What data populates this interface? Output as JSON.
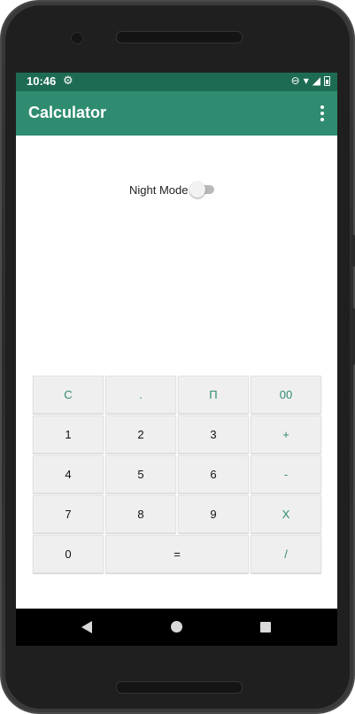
{
  "status_bar": {
    "time": "10:46",
    "icons": [
      "gear-icon",
      "do-not-disturb-icon",
      "wifi-icon",
      "signal-icon",
      "battery-icon"
    ]
  },
  "app_bar": {
    "title": "Calculator",
    "menu_icon": "more-vert-icon",
    "colors": {
      "app_bar": "#2f8c71",
      "status_bar": "#1e6b53"
    }
  },
  "night_mode": {
    "label": "Night Mode",
    "enabled": false
  },
  "keypad": {
    "accent_color": "#2f8c71",
    "rows": [
      [
        {
          "label": "C",
          "accent": true
        },
        {
          "label": ".",
          "accent": true
        },
        {
          "label": "Π",
          "accent": true
        },
        {
          "label": "00",
          "accent": true
        }
      ],
      [
        {
          "label": "1"
        },
        {
          "label": "2"
        },
        {
          "label": "3"
        },
        {
          "label": "+",
          "accent": true
        }
      ],
      [
        {
          "label": "4"
        },
        {
          "label": "5"
        },
        {
          "label": "6"
        },
        {
          "label": "-",
          "accent": true
        }
      ],
      [
        {
          "label": "7"
        },
        {
          "label": "8"
        },
        {
          "label": "9"
        },
        {
          "label": "X",
          "accent": true
        }
      ],
      [
        {
          "label": "0"
        },
        {
          "label": "=",
          "wide": true
        },
        {
          "label": "/",
          "accent": true
        }
      ]
    ]
  },
  "nav_bar": {
    "buttons": [
      "back-icon",
      "home-icon",
      "recents-icon"
    ]
  }
}
